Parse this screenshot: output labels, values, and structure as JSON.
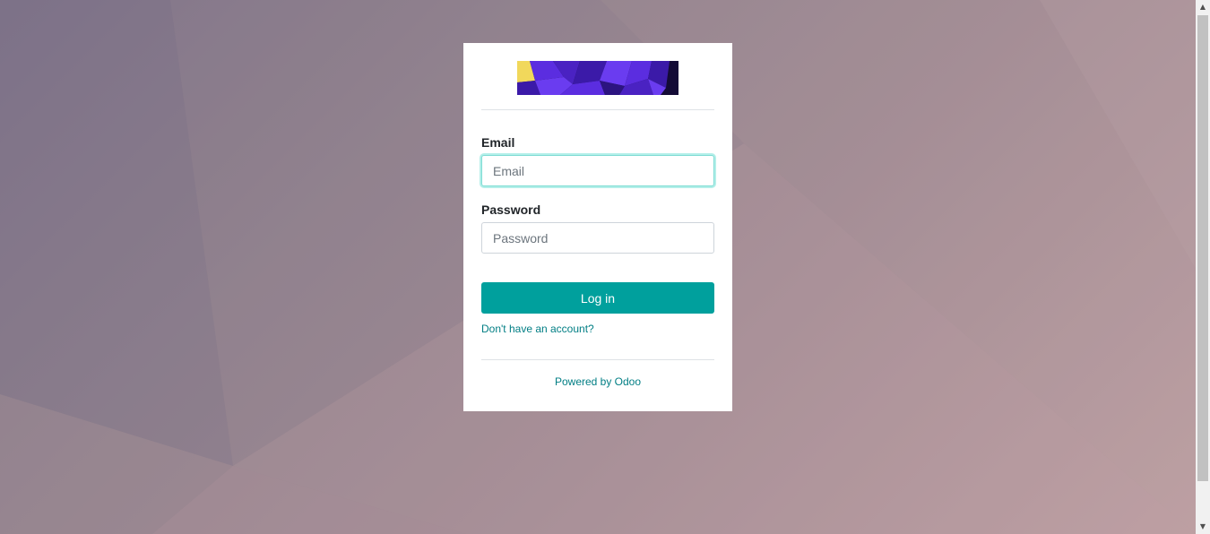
{
  "logo": {
    "colors": [
      "#f1d85b",
      "#5b2de0",
      "#3b1aa8",
      "#140b36"
    ]
  },
  "form": {
    "email_label": "Email",
    "email_placeholder": "Email",
    "email_value": "",
    "password_label": "Password",
    "password_placeholder": "Password",
    "password_value": "",
    "login_label": "Log in",
    "signup_link": "Don't have an account?"
  },
  "footer": {
    "powered_prefix": "Powered by ",
    "powered_brand": "Odoo"
  },
  "colors": {
    "accent": "#00a09d",
    "link": "#017e84",
    "focus_border": "#7fdcd4"
  },
  "scrollbar": {
    "up_icon": "chevron-up-icon",
    "down_icon": "chevron-down-icon"
  }
}
